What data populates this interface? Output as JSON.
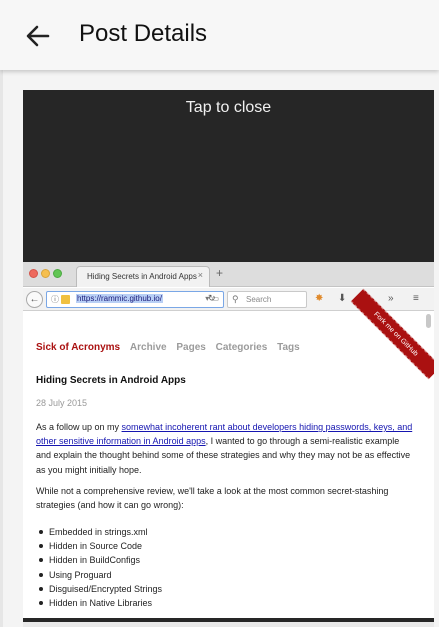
{
  "appbar": {
    "title": "Post Details"
  },
  "overlay": {
    "close_label": "Tap to close"
  },
  "browser": {
    "tab_title": "Hiding Secrets in Android Apps",
    "tab_close": "×",
    "new_tab": "+",
    "url": "https://rammic.github.io/",
    "search_placeholder": "Search"
  },
  "site": {
    "brand": "Sick of Acronyms",
    "nav": [
      "Archive",
      "Pages",
      "Categories",
      "Tags"
    ],
    "ribbon": "Fork me on GitHub",
    "post_title": "Hiding Secrets in Android Apps",
    "post_date": "28 July 2015",
    "para1_prefix": "As a follow up on my ",
    "para1_link": "somewhat incoherent rant about developers hiding passwords, keys, and other sensitive information in Android apps",
    "para1_suffix": ", I wanted to go through a semi-realistic example and explain the thought behind some of these strategies and why they may not be as effective as you might initially hope.",
    "para2": "While not a comprehensive review, we'll take a look at the most common secret-stashing strategies (and how it can go wrong):",
    "list": [
      "Embedded in strings.xml",
      "Hidden in Source Code",
      "Hidden in BuildConfigs",
      "Using Proguard",
      "Disguised/Encrypted Strings",
      "Hidden in Native Libraries"
    ]
  }
}
